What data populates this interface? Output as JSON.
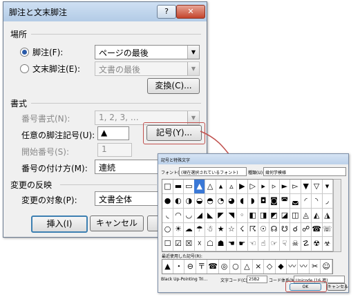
{
  "main_dialog": {
    "title": "脚注と文末脚注",
    "help_label": "?",
    "close_label": "✕",
    "location": {
      "heading": "場所",
      "footnote_label": "脚注(F):",
      "footnote_value": "ページの最後",
      "endnote_label": "文末脚注(E):",
      "endnote_value": "文書の最後",
      "convert_button": "変換(C)..."
    },
    "format": {
      "heading": "書式",
      "number_format_label": "番号書式(N):",
      "number_format_value": "1, 2, 3, …",
      "custom_mark_label": "任意の脚注記号(U):",
      "custom_mark_value": "▲",
      "symbol_button": "記号(Y)...",
      "start_at_label": "開始番号(S):",
      "start_at_value": "1",
      "numbering_label": "番号の付け方(M):",
      "numbering_value": "連続"
    },
    "apply": {
      "heading": "変更の反映",
      "apply_to_label": "変更の対象(P):",
      "apply_to_value": "文書全体"
    },
    "insert_button": "挿入(I)",
    "cancel_button": "キャンセル"
  },
  "symbol_dialog": {
    "title": "記号と特殊文字",
    "font_label": "フォント(F):",
    "font_value": "(現在選択されているフォント)",
    "subset_label": "種類(U):",
    "subset_value": "幾何学模様",
    "recent_label": "最近使用した記号(R):",
    "char_name": "Black Up-Pointing Tri…",
    "char_code_label": "文字コード(C):",
    "char_code_value": "25B2",
    "from_label": "コード体系(M):",
    "from_value": "Unicode (16 進)",
    "ok_button": "OK",
    "cancel_button": "キャンセル",
    "rows": [
      [
        "□",
        "▬",
        "▭",
        "▲",
        "△",
        "▴",
        "▵",
        "▶",
        "▷",
        "▸",
        "▹",
        "►",
        "▻",
        "▼",
        "▽",
        "▾"
      ],
      [
        "●",
        "◐",
        "◑",
        "◒",
        "◓",
        "◔",
        "◕",
        "◖",
        "◗",
        "◘",
        "◙",
        "◚",
        "◛",
        "◜",
        "◝",
        "◞"
      ],
      [
        "◟",
        "◠",
        "◡",
        "◢",
        "◣",
        "◤",
        "◥",
        "◦",
        "◧",
        "◨",
        "◩",
        "◪",
        "◫",
        "◬",
        "◭",
        "◮"
      ],
      [
        "○",
        "☀",
        "☁",
        "☂",
        "☃",
        "★",
        "☆",
        "☇",
        "☈",
        "☉",
        "☊",
        "☋",
        "☌",
        "☍",
        "☎",
        "☏"
      ],
      [
        "☐",
        "☑",
        "☒",
        "☓",
        "☖",
        "☗",
        "☚",
        "☛",
        "☜",
        "☝",
        "☞",
        "☟",
        "☠",
        "☡",
        "☢",
        "☣"
      ]
    ],
    "recent": [
      "▲",
      "・",
      "⊖",
      "〒",
      "☎",
      "◎",
      "○",
      "△",
      "×",
      "◇",
      "◆",
      "〰",
      "〰",
      "✂",
      "☺"
    ]
  },
  "colors": {
    "highlight": "#c0504d",
    "selection": "#3a78d6"
  }
}
